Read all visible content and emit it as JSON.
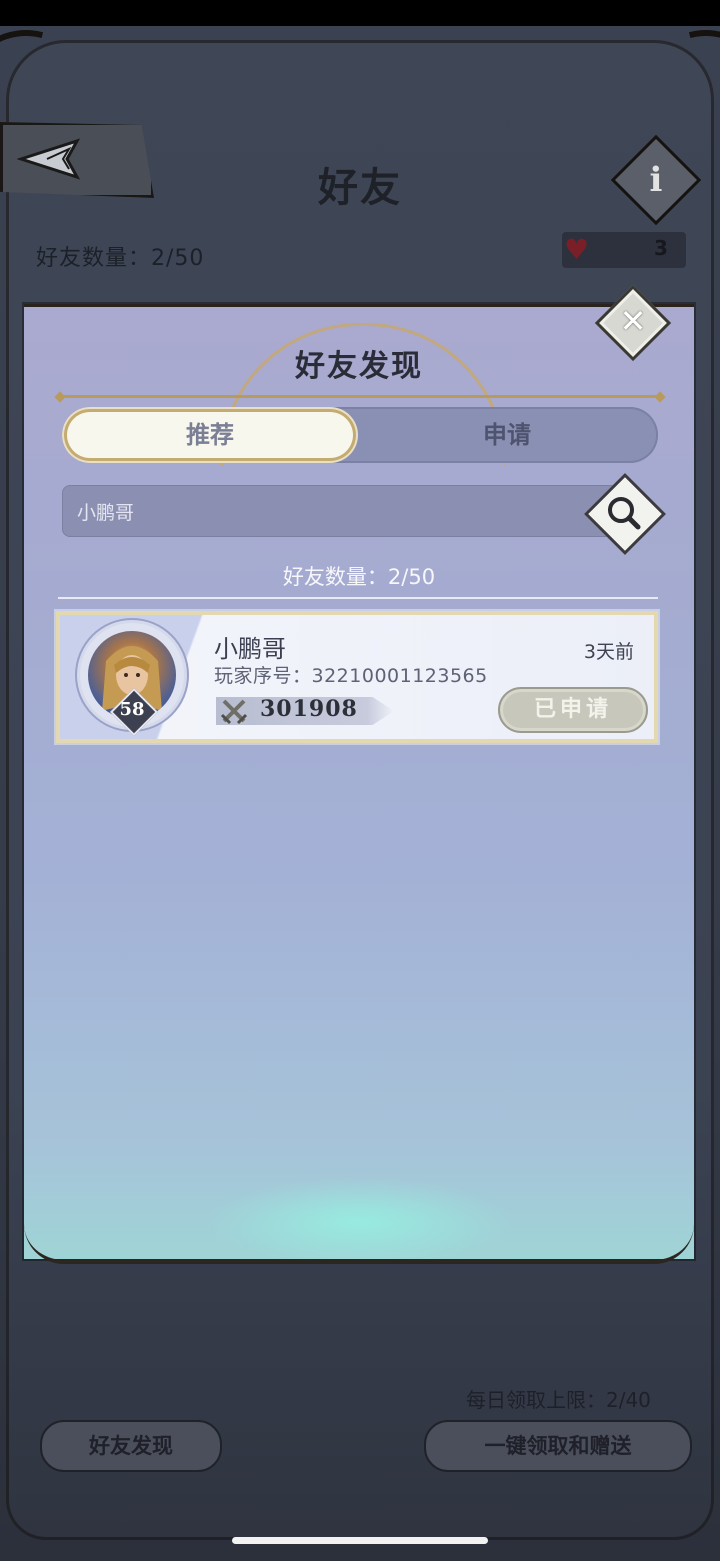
{
  "page": {
    "title": "好友",
    "friend_count": "好友数量：2/50",
    "hearts": "3",
    "daily_limit": "每日领取上限：2/40",
    "friend_discover_button": "好友发现",
    "claim_all_button": "一键领取和赠送"
  },
  "modal": {
    "title": "好友发现",
    "tabs": [
      {
        "label": "推荐",
        "active": true
      },
      {
        "label": "申请",
        "active": false
      }
    ],
    "search": {
      "value": "小鹏哥"
    },
    "friend_count": "好友数量：2/50",
    "results": [
      {
        "name": "小鹏哥",
        "player_id_label": "玩家序号：32210001123565",
        "level": "58",
        "power": "301908",
        "last_online": "3天前",
        "action": "已申请"
      }
    ]
  },
  "colors": {
    "accent_gold": "#c4ab6f",
    "modal_top": "#aaa9cf",
    "modal_bottom": "#9fd4d6",
    "tab_active_bg": "#f8f7ee"
  },
  "icons": [
    "back-arrow-icon",
    "info-icon",
    "heart-icon",
    "close-icon",
    "search-icon",
    "power-swords-icon"
  ]
}
